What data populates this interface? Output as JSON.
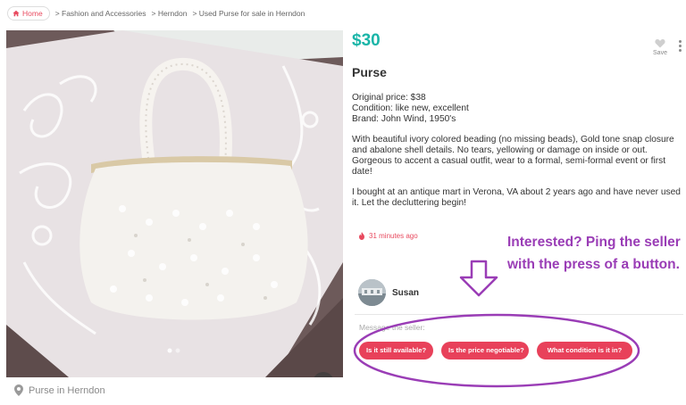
{
  "breadcrumb": {
    "home": "Home",
    "items": [
      "> Fashion and Accessories",
      "> Herndon",
      "> Used Purse for sale in Herndon"
    ]
  },
  "listing": {
    "price": "$30",
    "title": "Purse",
    "description": [
      "Original price: $38\nCondition: like new, excellent\nBrand: John Wind, 1950's",
      "With beautiful ivory colored beading (no missing beads), Gold tone snap closure and abalone shell details.  No tears, yellowing or damage on inside or out.  Gorgeous to accent a casual outfit, wear to a formal, semi-formal event or first date!",
      "I bought at an antique mart in Verona, VA about 2 years ago and have never used it.  Let the decluttering begin!"
    ],
    "posted": "31 minutes ago",
    "location": "Purse in Herndon"
  },
  "actions": {
    "save_label": "Save"
  },
  "seller": {
    "name": "Susan"
  },
  "message": {
    "label": "Message the seller:",
    "chips": [
      "Is it still available?",
      "Is the price negotiable?",
      "What condition is it in?"
    ]
  },
  "annotation": {
    "text": "Interested? Ping the seller with the press of a button."
  },
  "colors": {
    "accent": "#e8415a",
    "price": "#1ab5a8",
    "annotation": "#9a3db6"
  },
  "icons": {
    "home": "home-icon",
    "heart": "heart-icon",
    "more": "kebab-icon",
    "fire": "fire-icon",
    "pin": "location-pin-icon",
    "prev": "chevron-left-icon",
    "next": "chevron-right-icon",
    "arrow": "down-arrow-icon"
  }
}
